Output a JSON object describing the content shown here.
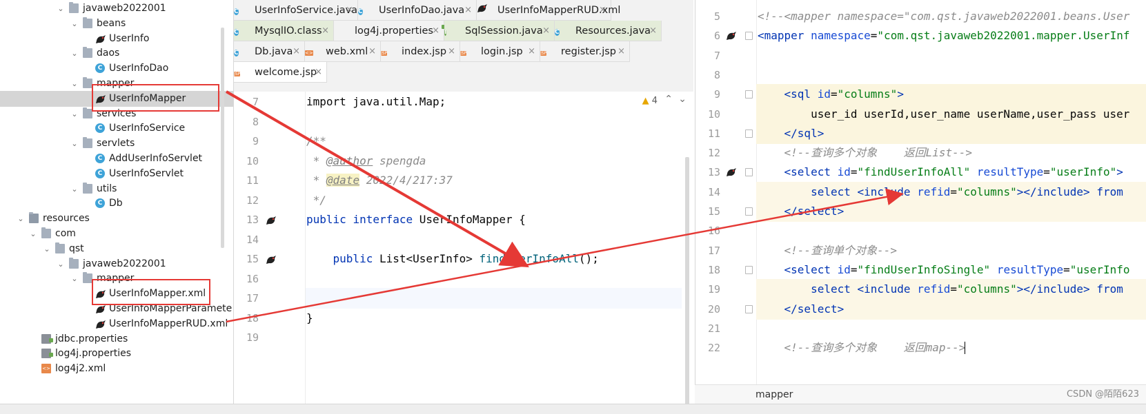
{
  "tree": {
    "items": [
      {
        "label": "javaweb2022001",
        "icon": "folder-icon",
        "level": 4,
        "expanded": true
      },
      {
        "label": "beans",
        "icon": "folder-icon",
        "level": 5,
        "expanded": true
      },
      {
        "label": "UserInfo",
        "icon": "mybatis-bird-icon",
        "level": 6
      },
      {
        "label": "daos",
        "icon": "folder-icon",
        "level": 5,
        "expanded": true
      },
      {
        "label": "UserInfoDao",
        "icon": "class-icon",
        "level": 6
      },
      {
        "label": "mapper",
        "icon": "folder-icon",
        "level": 5,
        "expanded": true
      },
      {
        "label": "UserInfoMapper",
        "icon": "mybatis-bird-icon",
        "level": 6,
        "selected": true
      },
      {
        "label": "services",
        "icon": "folder-icon",
        "level": 5,
        "expanded": true
      },
      {
        "label": "UserInfoService",
        "icon": "class-icon",
        "level": 6
      },
      {
        "label": "servlets",
        "icon": "folder-icon",
        "level": 5,
        "expanded": true
      },
      {
        "label": "AddUserInfoServlet",
        "icon": "class-icon",
        "level": 6
      },
      {
        "label": "UserInfoServlet",
        "icon": "class-icon",
        "level": 6
      },
      {
        "label": "utils",
        "icon": "folder-icon",
        "level": 5,
        "expanded": true
      },
      {
        "label": "Db",
        "icon": "class-icon",
        "level": 6
      },
      {
        "label": "resources",
        "icon": "resources-folder-icon",
        "level": 1,
        "expanded": true
      },
      {
        "label": "com",
        "icon": "folder-icon",
        "level": 2,
        "expanded": true
      },
      {
        "label": "qst",
        "icon": "folder-icon",
        "level": 3,
        "expanded": true
      },
      {
        "label": "javaweb2022001",
        "icon": "folder-icon",
        "level": 4,
        "expanded": true
      },
      {
        "label": "mapper",
        "icon": "folder-icon",
        "level": 5,
        "expanded": true
      },
      {
        "label": "UserInfoMapper.xml",
        "icon": "mybatis-bird-icon",
        "level": 6
      },
      {
        "label": "UserInfoMapperParamete",
        "icon": "mybatis-bird-icon",
        "level": 6
      },
      {
        "label": "UserInfoMapperRUD.xml",
        "icon": "mybatis-bird-icon",
        "level": 6
      },
      {
        "label": "jdbc.properties",
        "icon": "properties-icon",
        "level": 2
      },
      {
        "label": "log4j.properties",
        "icon": "properties-icon",
        "level": 2
      },
      {
        "label": "log4j2.xml",
        "icon": "xml-icon",
        "level": 2
      }
    ]
  },
  "tabs": {
    "row1": [
      {
        "label": "UserInfoService.java",
        "icon": "class-icon"
      },
      {
        "label": "UserInfoDao.java",
        "icon": "class-icon"
      },
      {
        "label": "UserInfoMapperRUD.xml",
        "icon": "mybatis-bird-icon"
      }
    ],
    "row2": [
      {
        "label": "MysqlIO.class",
        "icon": "class-icon",
        "green": true
      },
      {
        "label": "log4j.properties",
        "icon": "properties-icon"
      },
      {
        "label": "SqlSession.java",
        "icon": "interface-icon",
        "green": true
      },
      {
        "label": "Resources.java",
        "icon": "class-icon",
        "green": true
      }
    ],
    "row3": [
      {
        "label": "Db.java",
        "icon": "class-icon"
      },
      {
        "label": "web.xml",
        "icon": "xml-icon"
      },
      {
        "label": "index.jsp",
        "icon": "jsp-icon"
      },
      {
        "label": "login.jsp",
        "icon": "jsp-icon"
      },
      {
        "label": "register.jsp",
        "icon": "jsp-icon"
      }
    ],
    "row4": [
      {
        "label": "welcome.jsp",
        "icon": "jsp-icon",
        "active": true
      }
    ],
    "close_glyph": "×"
  },
  "left_editor": {
    "warning_count": "4",
    "lines": [
      {
        "n": "7",
        "text": "import java.util.Map;"
      },
      {
        "n": "8",
        "text": ""
      },
      {
        "n": "9",
        "text": "/**"
      },
      {
        "n": "10",
        "tag": "@author",
        "rest": " spengda"
      },
      {
        "n": "11",
        "tag": "@date",
        "rest": " 2022/4/217:37"
      },
      {
        "n": "12",
        "text": " */"
      },
      {
        "n": "13",
        "kw1": "public",
        "kw2": "interface",
        "name": "UserInfoMapper {"
      },
      {
        "n": "14",
        "text": ""
      },
      {
        "n": "15",
        "kw1": "public",
        "type": "List<UserInfo>",
        "meth": "findUserInfoAll",
        "end": "();"
      },
      {
        "n": "16",
        "text": ""
      },
      {
        "n": "17",
        "text": ""
      },
      {
        "n": "18",
        "text": "}"
      },
      {
        "n": "19",
        "text": ""
      }
    ]
  },
  "right_editor": {
    "lines": [
      {
        "n": "5",
        "comment": "<!--<mapper namespace=\"com.qst.javaweb2022001.beans.User"
      },
      {
        "n": "6",
        "open": "<mapper",
        "attr": "namespace",
        "val": "\"com.qst.javaweb2022001.mapper.UserInf"
      },
      {
        "n": "7"
      },
      {
        "n": "8"
      },
      {
        "n": "9",
        "sql_open": "<sql",
        "attr": "id",
        "val": "\"columns\"",
        "close": ">"
      },
      {
        "n": "10",
        "plain": "user_id userId,user_name userName,user_pass user"
      },
      {
        "n": "11",
        "tag": "</sql>"
      },
      {
        "n": "12",
        "comment": "<!--查询多个对象    返回List-->"
      },
      {
        "n": "13",
        "sel": "<select",
        "a1": "id",
        "v1": "\"findUserInfoAll\"",
        "a2": "resultType",
        "v2": "\"userInfo\"",
        "close": ">"
      },
      {
        "n": "14",
        "q1": "select ",
        "inc": "<include",
        "a": "refid",
        "v": "\"columns\"",
        "incc": "></include>",
        "tail": " from"
      },
      {
        "n": "15",
        "tag": "</select>"
      },
      {
        "n": "16"
      },
      {
        "n": "17",
        "comment": "<!--查询单个对象-->"
      },
      {
        "n": "18",
        "sel": "<select",
        "a1": "id",
        "v1": "\"findUserInfoSingle\"",
        "a2": "resultType",
        "v2": "\"userInfo"
      },
      {
        "n": "19",
        "q1": "select ",
        "inc": "<include",
        "a": "refid",
        "v": "\"columns\"",
        "incc": "></include>",
        "tail": " from"
      },
      {
        "n": "20",
        "tag": "</select>"
      },
      {
        "n": "21"
      },
      {
        "n": "22",
        "comment": "<!--查询多个对象    返回map-->"
      }
    ],
    "breadcrumb": "mapper"
  },
  "watermark": "CSDN @陌陌623",
  "colors": {
    "annotation_red": "#e53935",
    "keyword": "#0033b3",
    "string": "#067d17",
    "comment": "#8c8c8c"
  }
}
